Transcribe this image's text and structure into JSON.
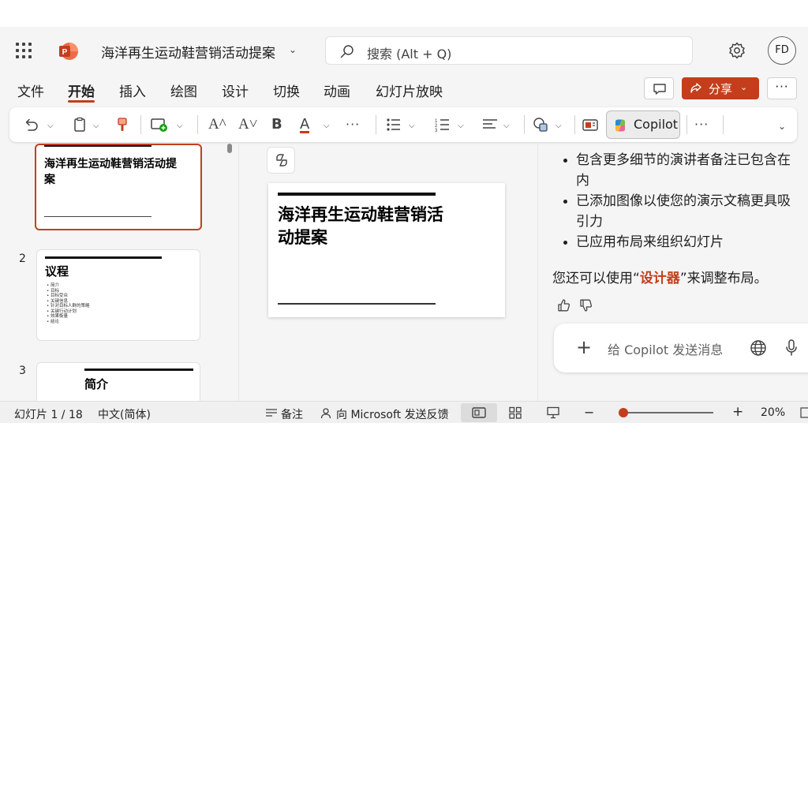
{
  "app": {
    "title": "海洋再生运动鞋营销活动提案",
    "avatar_initials": "FD",
    "icons": [
      "app-launcher-icon",
      "powerpoint-logo",
      "chevron-down-icon",
      "search-icon",
      "gear-icon"
    ]
  },
  "search": {
    "placeholder": "搜索 (Alt + Q)"
  },
  "menu": {
    "tabs": [
      "文件",
      "开始",
      "插入",
      "绘图",
      "设计",
      "切换",
      "动画",
      "幻灯片放映"
    ],
    "active_tab": "开始",
    "share_label": "分享",
    "more_label": "···"
  },
  "ribbon": {
    "font_grow": "A^",
    "font_shrink": "A˅",
    "bold": "B",
    "font_color": "A",
    "more": "···",
    "copilot_label": "Copilot",
    "overflow": "···",
    "icons": [
      "undo-icon",
      "clipboard-icon",
      "format-painter-icon",
      "new-slide-icon",
      "grow-font-icon",
      "shrink-font-icon",
      "bold-icon",
      "font-color-icon",
      "bullets-icon",
      "numbering-icon",
      "align-icon",
      "shapes-icon",
      "designer-icon",
      "copilot-icon"
    ],
    "font_color_accent": "#c43e1c"
  },
  "slides_pane": {
    "thumbs": [
      {
        "num": "1",
        "title": "海洋再生运动鞋营销活动提案",
        "selected": true
      },
      {
        "num": "2",
        "title": "议程",
        "items": [
          "简介",
          "目标",
          "目标受众",
          "关键信息",
          "针对目标人群的策略",
          "关键行动计划",
          "效果衡量",
          "结论"
        ]
      },
      {
        "num": "3",
        "title": "简介"
      }
    ]
  },
  "slide": {
    "title": "海洋再生运动鞋营销活动提案"
  },
  "copilot": {
    "bullets": [
      "包含更多细节的演讲者备注已包含在内",
      "已添加图像以使您的演示文稿更具吸引力",
      "已应用布局来组织幻灯片"
    ],
    "note_prefix": "您还可以使用“",
    "note_link": "设计器",
    "note_suffix": "”来调整布局。",
    "input_placeholder": "给 Copilot 发送消息"
  },
  "status": {
    "slide_counter": "幻灯片 1 / 18",
    "language": "中文(简体)",
    "notes_label": "备注",
    "feedback_label": "向 Microsoft 发送反馈",
    "zoom_minus": "−",
    "zoom_plus": "+",
    "zoom_level": "20%",
    "zoom_fraction": 0.02
  },
  "colors": {
    "accent": "#c43e1c",
    "app_background": "#f5f5f5"
  }
}
